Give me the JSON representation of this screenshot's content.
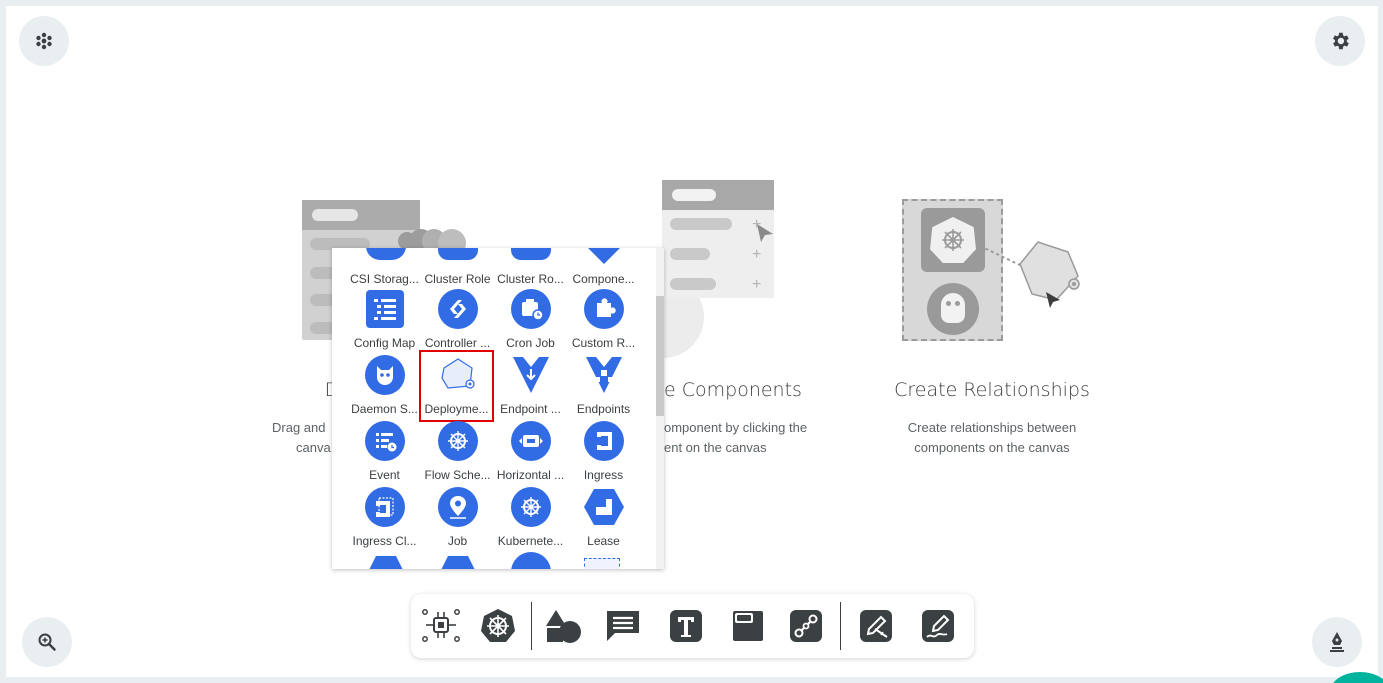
{
  "top_left_button": {
    "icon": "asterisk-icon"
  },
  "top_right_button": {
    "icon": "gear-icon"
  },
  "zoom_button": {
    "icon": "zoom-in-icon"
  },
  "pen_button": {
    "icon": "fountain-pen-icon"
  },
  "cards": [
    {
      "title_visible": "D",
      "desc_line1": "Drag and",
      "desc_line2": "canva"
    },
    {
      "title_visible": "e Components",
      "desc_line1": "omponent by clicking the",
      "desc_line2": "ent on the canvas"
    },
    {
      "title": "Create Relationships",
      "desc_line1": "Create relationships between",
      "desc_line2": "components on the canvas"
    }
  ],
  "palette": {
    "header_labels": [
      "CSI Storag...",
      "Cluster Role",
      "Cluster Ro...",
      "Compone..."
    ],
    "items": [
      {
        "label": "Config Map",
        "icon": "config-map-icon"
      },
      {
        "label": "Controller ...",
        "icon": "controller-revision-icon"
      },
      {
        "label": "Cron Job",
        "icon": "cron-job-icon"
      },
      {
        "label": "Custom R...",
        "icon": "custom-resource-icon"
      },
      {
        "label": "Daemon S...",
        "icon": "daemon-set-icon"
      },
      {
        "label": "Deployme...",
        "icon": "deployment-icon",
        "selected": true
      },
      {
        "label": "Endpoint ...",
        "icon": "endpoint-slice-icon"
      },
      {
        "label": "Endpoints",
        "icon": "endpoints-icon"
      },
      {
        "label": "Event",
        "icon": "event-icon"
      },
      {
        "label": "Flow Sche...",
        "icon": "flow-schema-icon"
      },
      {
        "label": "Horizontal ...",
        "icon": "horizontal-pod-autoscaler-icon"
      },
      {
        "label": "Ingress",
        "icon": "ingress-icon"
      },
      {
        "label": "Ingress Cl...",
        "icon": "ingress-class-icon"
      },
      {
        "label": "Job",
        "icon": "job-icon"
      },
      {
        "label": "Kubernete...",
        "icon": "kubernetes-icon"
      },
      {
        "label": "Lease",
        "icon": "lease-icon"
      }
    ]
  },
  "toolbar": {
    "buttons": [
      {
        "icon": "components-icon"
      },
      {
        "icon": "kubernetes-helm-icon"
      },
      {
        "icon": "shapes-icon"
      },
      {
        "icon": "comment-icon"
      },
      {
        "icon": "text-icon"
      },
      {
        "icon": "section-icon"
      },
      {
        "icon": "edge-icon"
      },
      {
        "icon": "pencil-ruler-icon"
      },
      {
        "icon": "freehand-pen-icon"
      }
    ]
  },
  "colors": {
    "accent_blue": "#326ce5",
    "dark_icon": "#3b4043",
    "teal": "#00b39f",
    "selection_red": "#e00000"
  }
}
